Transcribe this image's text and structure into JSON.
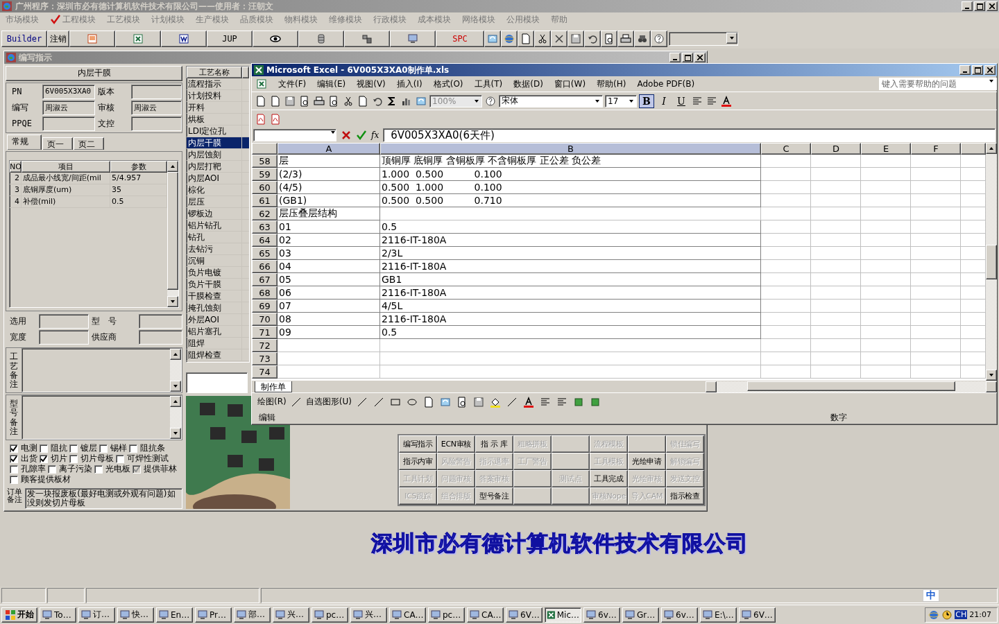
{
  "app_title": "广州程序：深圳市必有德计算机软件技术有限公司——使用者：汪朝文",
  "main_menu": [
    {
      "label": "市场模块",
      "checked": false
    },
    {
      "label": "工程模块",
      "checked": true
    },
    {
      "label": "工艺模块",
      "checked": false
    },
    {
      "label": "计划模块",
      "checked": false
    },
    {
      "label": "生产模块",
      "checked": false
    },
    {
      "label": "品质模块",
      "checked": false
    },
    {
      "label": "物料模块",
      "checked": false
    },
    {
      "label": "维修模块",
      "checked": false
    },
    {
      "label": "行政模块",
      "checked": false
    },
    {
      "label": "成本模块",
      "checked": false
    },
    {
      "label": "网络模块",
      "checked": false
    },
    {
      "label": "公用模块",
      "checked": false
    },
    {
      "label": "帮助",
      "checked": false
    }
  ],
  "toolbar": [
    {
      "kind": "text",
      "label": "Builder",
      "color": "#000080"
    },
    {
      "kind": "text",
      "label": "注销",
      "color": "#000000"
    },
    {
      "kind": "slide"
    },
    {
      "kind": "sheet"
    },
    {
      "kind": "doc"
    },
    {
      "kind": "text",
      "label": "JUP",
      "color": "#000000"
    },
    {
      "kind": "eye"
    },
    {
      "kind": "database"
    },
    {
      "kind": "server"
    },
    {
      "kind": "monitor"
    },
    {
      "kind": "text",
      "label": "SPC",
      "color": "#cc0000"
    },
    {
      "kind": "sync"
    },
    {
      "kind": "globe"
    },
    {
      "kind": "page"
    },
    {
      "kind": "scissors"
    },
    {
      "kind": "cross"
    },
    {
      "kind": "disk"
    },
    {
      "kind": "undo"
    },
    {
      "kind": "preview"
    },
    {
      "kind": "printer"
    },
    {
      "kind": "binoculars"
    },
    {
      "kind": "help"
    },
    {
      "kind": "combo"
    }
  ],
  "child_window": {
    "title": "编写指示"
  },
  "process_panel": {
    "title": "内层干膜",
    "fields": [
      {
        "label": "PN",
        "value": "6V005X3XA0"
      },
      {
        "label": "版本"
      },
      {
        "label": "编写",
        "value": "周淑云"
      },
      {
        "label": "审核",
        "value": "周淑云"
      },
      {
        "label": "PPQE"
      },
      {
        "label": "文控"
      }
    ],
    "tabs": [
      {
        "label": "常规",
        "selected": true
      },
      {
        "label": "页一",
        "selected": false
      },
      {
        "label": "页二",
        "selected": false
      }
    ],
    "params_table": {
      "columns": [
        "NO",
        "项目",
        "参数"
      ],
      "rows": [
        [
          "2",
          "成品最小线宽/间距(mil",
          "5/4.957"
        ],
        [
          "3",
          "底铜厚度(um)",
          "35"
        ],
        [
          "4",
          "补偿(mil)",
          "0.5"
        ]
      ]
    },
    "material_fields": [
      {
        "label": "选用"
      },
      {
        "label": "型　号"
      },
      {
        "label": "宽度"
      },
      {
        "label": "供应商"
      }
    ],
    "memos": [
      {
        "label": "工艺备注"
      },
      {
        "label": "型号备注"
      }
    ],
    "option_rows": [
      [
        {
          "label": "电测",
          "checked": true,
          "disabled": false
        },
        {
          "label": "阻抗",
          "checked": false,
          "disabled": false
        },
        {
          "label": "镀层",
          "checked": false,
          "disabled": false
        },
        {
          "label": "锡样",
          "checked": false,
          "disabled": false
        },
        {
          "label": "阻抗条",
          "checked": false,
          "disabled": false
        }
      ],
      [
        {
          "label": "出货",
          "checked": true,
          "disabled": false
        },
        {
          "label": "切片",
          "checked": true,
          "disabled": false
        },
        {
          "label": "切片母板",
          "checked": false,
          "disabled": false
        },
        {
          "label": "可焊性测试",
          "checked": false,
          "disabled": false
        }
      ],
      [
        {
          "label": "孔隙率",
          "checked": false,
          "disabled": false
        },
        {
          "label": "离子污染",
          "checked": false,
          "disabled": false
        },
        {
          "label": "光电板",
          "checked": false,
          "disabled": false
        },
        {
          "label": "提供菲林",
          "checked": true,
          "disabled": true
        }
      ],
      [
        {
          "label": "顾客提供板材",
          "checked": false,
          "disabled": false
        }
      ]
    ],
    "order_note": {
      "label": "订单备注",
      "value": "发一块报废板(最好电测或外观有问题)如没则发切片母板"
    }
  },
  "process_list": {
    "column": "工艺名称",
    "items": [
      {
        "label": "流程指示",
        "selected": false
      },
      {
        "label": "计划投料",
        "selected": false
      },
      {
        "label": "开料",
        "selected": false
      },
      {
        "label": "烘板",
        "selected": false
      },
      {
        "label": "LDI定位孔",
        "selected": false
      },
      {
        "label": "内层干膜",
        "selected": true
      },
      {
        "label": "内层蚀刻",
        "selected": false
      },
      {
        "label": "内层打靶",
        "selected": false
      },
      {
        "label": "内层AOI",
        "selected": false
      },
      {
        "label": "棕化",
        "selected": false
      },
      {
        "label": "层压",
        "selected": false
      },
      {
        "label": "锣板边",
        "selected": false
      },
      {
        "label": "铝片钻孔",
        "selected": false
      },
      {
        "label": "钻孔",
        "selected": false
      },
      {
        "label": "去钻污",
        "selected": false
      },
      {
        "label": "沉铜",
        "selected": false
      },
      {
        "label": "负片电镀",
        "selected": false
      },
      {
        "label": "负片干膜",
        "selected": false
      },
      {
        "label": "干膜检查",
        "selected": false
      },
      {
        "label": "掩孔蚀刻",
        "selected": false
      },
      {
        "label": "外层AOI",
        "selected": false
      },
      {
        "label": "铝片塞孔",
        "selected": false
      },
      {
        "label": "阻焊",
        "selected": false
      },
      {
        "label": "阻焊检查",
        "selected": false
      }
    ]
  },
  "action_buttons": [
    [
      {
        "kind": "action",
        "label": "编写指示",
        "disabled": false
      },
      {
        "kind": "action",
        "label": "ECN审核",
        "disabled": false
      },
      {
        "kind": "action",
        "label": "指 示 库",
        "disabled": false
      },
      {
        "kind": "action",
        "label": "粗略拼板",
        "disabled": true
      },
      {
        "kind": "blank"
      },
      {
        "kind": "action",
        "label": "流程模板",
        "disabled": true
      },
      {
        "kind": "blank"
      },
      {
        "kind": "action",
        "label": "锁住编写",
        "disabled": true
      }
    ],
    [
      {
        "kind": "action",
        "label": "指示内审",
        "disabled": false
      },
      {
        "kind": "action",
        "label": "风险警告",
        "disabled": true
      },
      {
        "kind": "action",
        "label": "指示退率",
        "disabled": true
      },
      {
        "kind": "action",
        "label": "工厂警告",
        "disabled": true
      },
      {
        "kind": "blank"
      },
      {
        "kind": "action",
        "label": "工具模板",
        "disabled": true
      },
      {
        "kind": "action",
        "label": "光绘申请",
        "disabled": false
      },
      {
        "kind": "action",
        "label": "解锁编写",
        "disabled": true
      }
    ],
    [
      {
        "kind": "action",
        "label": "工具计划",
        "disabled": true
      },
      {
        "kind": "action",
        "label": "问题审核",
        "disabled": true
      },
      {
        "kind": "action",
        "label": "答案审核",
        "disabled": true
      },
      {
        "kind": "blank"
      },
      {
        "kind": "action",
        "label": "测试点",
        "disabled": true
      },
      {
        "kind": "action",
        "label": "工具完成",
        "disabled": false
      },
      {
        "kind": "action",
        "label": "光绘审核",
        "disabled": true
      },
      {
        "kind": "action",
        "label": "发送文控",
        "disabled": true
      }
    ],
    [
      {
        "kind": "action",
        "label": "ICS跟踪",
        "disabled": true
      },
      {
        "kind": "action",
        "label": "组合排版",
        "disabled": true
      },
      {
        "kind": "action",
        "label": "型号备注",
        "disabled": false
      },
      {
        "kind": "blank"
      },
      {
        "kind": "blank"
      },
      {
        "kind": "action",
        "label": "审核Nope",
        "disabled": true
      },
      {
        "kind": "action",
        "label": "导入CAM",
        "disabled": true
      },
      {
        "kind": "action",
        "label": "指示检查",
        "disabled": false
      }
    ]
  ],
  "excel": {
    "title": "Microsoft Excel - 6V005X3XA0制作单.xls",
    "menu": [
      "文件(F)",
      "编辑(E)",
      "视图(V)",
      "插入(I)",
      "格式(O)",
      "工具(T)",
      "数据(D)",
      "窗口(W)",
      "帮助(H)",
      "Adobe PDF(B)"
    ],
    "help_placeholder": "键入需要帮助的问题",
    "zoom": "100%",
    "font": "宋体",
    "font_size": "17",
    "format_buttons": [
      {
        "label": "B",
        "selected": true
      },
      {
        "label": "I",
        "selected": false
      },
      {
        "label": "U",
        "selected": false
      }
    ],
    "function_symbol": "fx",
    "formula": "6V005X3XA0(6天件)",
    "columns": [
      {
        "label": "A",
        "selected": true
      },
      {
        "label": "B",
        "selected": true
      },
      {
        "label": "C",
        "selected": false
      },
      {
        "label": "D",
        "selected": false
      },
      {
        "label": "E",
        "selected": false
      },
      {
        "label": "F",
        "selected": false
      }
    ],
    "rows": [
      {
        "number": "58",
        "a": "层",
        "b": "顶铜厚 底铜厚 含铜板厚 不含铜板厚 正公差 负公差"
      },
      {
        "number": "59",
        "a": "(2/3)",
        "b": "1.000  0.500          0.100"
      },
      {
        "number": "60",
        "a": "(4/5)",
        "b": "0.500  1.000          0.100"
      },
      {
        "number": "61",
        "a": "(GB1)",
        "b": "0.500  0.500          0.710"
      },
      {
        "number": "62",
        "a": "层压叠层结构"
      },
      {
        "number": "63",
        "a": "01",
        "b": "0.5"
      },
      {
        "number": "64",
        "a": "02",
        "b": "2116-IT-180A"
      },
      {
        "number": "65",
        "a": "03",
        "b": "2/3L"
      },
      {
        "number": "66",
        "a": "04",
        "b": "2116-IT-180A"
      },
      {
        "number": "67",
        "a": "05",
        "b": "GB1"
      },
      {
        "number": "68",
        "a": "06",
        "b": "2116-IT-180A"
      },
      {
        "number": "69",
        "a": "07",
        "b": "4/5L"
      },
      {
        "number": "70",
        "a": "08",
        "b": "2116-IT-180A"
      },
      {
        "number": "71",
        "a": "09",
        "b": "0.5"
      },
      {
        "number": "72"
      },
      {
        "number": "73"
      },
      {
        "number": "74"
      }
    ],
    "sheet_tabs": [
      {
        "label": "制作单",
        "selected": true
      }
    ],
    "drawing_toolbar": [
      "绘图(R)",
      "自选图形(U)"
    ],
    "status": "编辑",
    "status_mode": "数字"
  },
  "banner": "深圳市必有德计算机软件技术有限公司",
  "ime_bar": {
    "mode": "中"
  },
  "taskbar": {
    "start": "开始",
    "items": [
      {
        "label": "To…",
        "selected": false
      },
      {
        "label": "订…",
        "selected": false
      },
      {
        "label": "快…",
        "selected": false
      },
      {
        "label": "En…",
        "selected": false
      },
      {
        "label": "Pr…",
        "selected": false
      },
      {
        "label": "部…",
        "selected": false
      },
      {
        "label": "兴…",
        "selected": false
      },
      {
        "label": "pc…",
        "selected": false
      },
      {
        "label": "兴…",
        "selected": false
      },
      {
        "label": "CA…",
        "selected": false
      },
      {
        "label": "pc…",
        "selected": false
      },
      {
        "label": "CA…",
        "selected": false
      },
      {
        "label": "6V…",
        "selected": false
      },
      {
        "label": "Mic…",
        "selected": true
      },
      {
        "label": "6v…",
        "selected": false
      },
      {
        "label": "Gr…",
        "selected": false
      },
      {
        "label": "6v…",
        "selected": false
      },
      {
        "label": "E:\\…",
        "selected": false
      },
      {
        "label": "6V…",
        "selected": false
      }
    ],
    "language": "CH",
    "clock": "21:07"
  }
}
